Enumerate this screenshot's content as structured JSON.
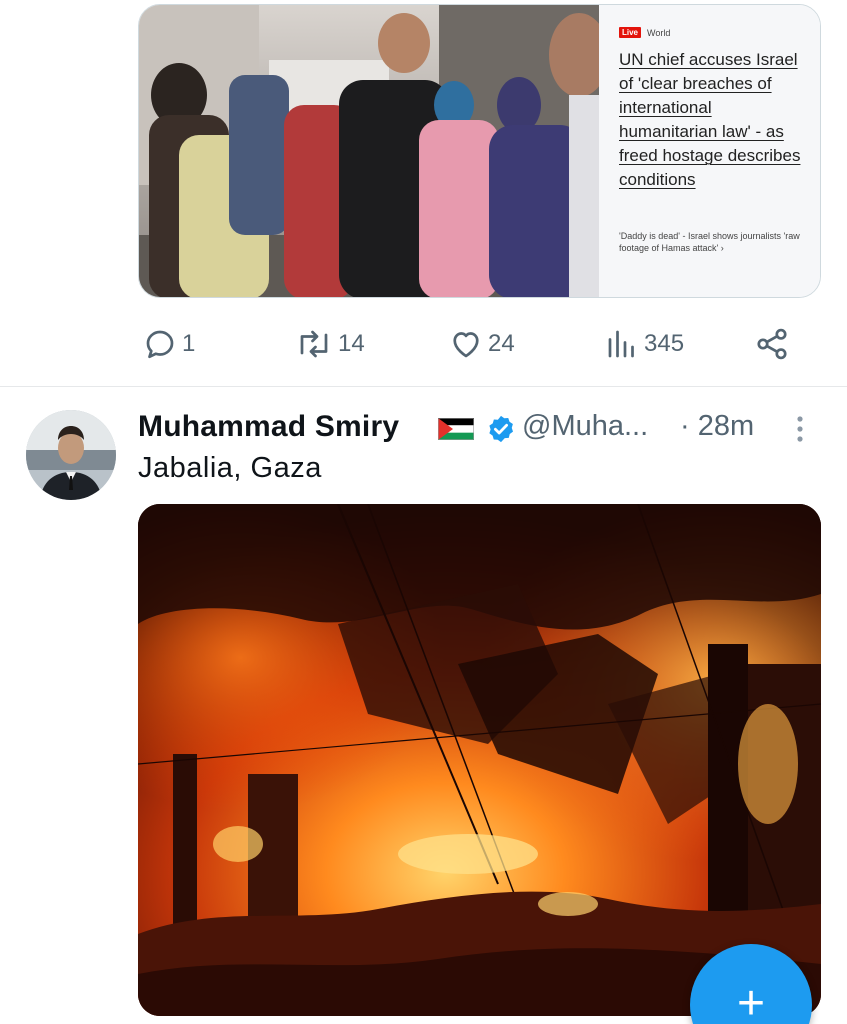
{
  "tweet1": {
    "card": {
      "live_badge": "Live",
      "section": "World",
      "headline": "UN chief accuses Israel of 'clear breaches of international humanitarian law' - as freed hostage describes conditions",
      "subheadline": "'Daddy is dead' - Israel shows journalists 'raw footage of Hamas attack' ›"
    },
    "actions": {
      "replies": "1",
      "reposts": "14",
      "likes": "24",
      "views": "345"
    }
  },
  "tweet2": {
    "author_name": "Muhammad Smiry",
    "handle": "@Muha...",
    "time": "· 28m",
    "location_text": "Jabalia, Gaza"
  },
  "fab": {
    "label": "+"
  },
  "colors": {
    "accent": "#1d9bf0",
    "secondary_text": "#536471",
    "live_red": "#e3140c"
  }
}
